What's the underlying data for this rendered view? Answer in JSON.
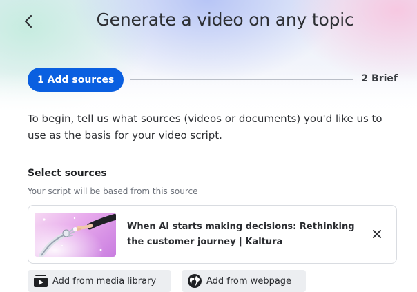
{
  "header": {
    "title": "Generate a video on any topic",
    "back_icon": "chevron-left-icon"
  },
  "stepper": {
    "steps": [
      {
        "label": "1 Add sources",
        "active": true
      },
      {
        "label": "2 Brief",
        "active": false
      }
    ],
    "active_color": "#0a5fe0"
  },
  "intro": {
    "text": "To begin, tell us what sources (videos or documents) you'd like us to use as the basis for your video script."
  },
  "sources": {
    "title": "Select sources",
    "subtitle": "Your script will be based from this source",
    "items": [
      {
        "title": "When AI starts making decisions: Rethinking the customer journey | Kaltura",
        "thumbnail_icon": "robot-hand-thumbnail",
        "remove_icon": "close-icon"
      }
    ]
  },
  "actions": {
    "media_library": {
      "label": "Add from media library",
      "icon": "media-library-icon"
    },
    "webpage": {
      "label": "Add from webpage",
      "icon": "globe-icon"
    }
  }
}
